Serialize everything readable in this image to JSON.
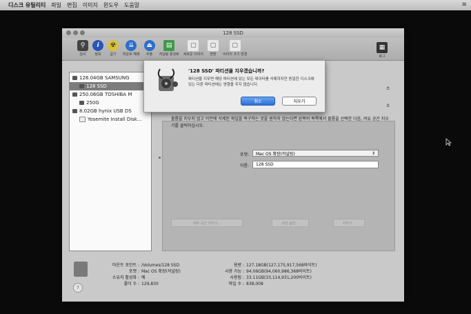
{
  "menubar": {
    "app_name": "디스크 유틸리티",
    "items": [
      "파일",
      "편집",
      "이미지",
      "윈도우",
      "도움말"
    ]
  },
  "window": {
    "title": "128 SSD"
  },
  "toolbar": {
    "items": [
      "검사",
      "정보",
      "굽기",
      "마운트 해제",
      "추출",
      "저널링 활성화",
      "새로운 이미지",
      "변환",
      "이미지 크기 변경"
    ],
    "log_label": "로그"
  },
  "sidebar": {
    "items": [
      {
        "label": "128.04GB SAMSUNG",
        "selected": false
      },
      {
        "label": "128 SSD",
        "selected": true
      },
      {
        "label": "250.06GB TOSHIBA M",
        "selected": false
      },
      {
        "label": "250G",
        "selected": false
      },
      {
        "label": "8.02GB hynix USB DS",
        "selected": false
      },
      {
        "label": "Yosemite Install Disk...",
        "selected": false
      }
    ]
  },
  "dialog": {
    "title": "'128 SSD' 파티션을 지우겠습니까?",
    "message": "파티션을 지우면 해당 파티션에 있는 모든 데이터를 삭제하지만 동일한 디스크에 있는 다른 파티션에는 영향을 주지 않습니다.",
    "cancel_label": "취소",
    "erase_label": "지우기"
  },
  "main": {
    "hint_right": "소",
    "hint_right2": "소",
    "description": "볼륨을 지우지 않고 이전에 삭제된 파일을 복구하는 것을 원하지 않는다면 왼쪽의 목록에서 볼륨을 선택한 다음, 여유 공간 지우기를 클릭하십시오.",
    "format_label": "포맷:",
    "format_value": "Mac OS 확장(저널링)",
    "name_label": "이름:",
    "name_value": "128 SSD",
    "free_space_button": "여유 공간 지우기...",
    "security_button": "보안 옵션...",
    "erase_button": "지우기..."
  },
  "info": {
    "mount_point_label": "마운트 포인트 :",
    "mount_point_value": "/Volumes/128 SSD",
    "format_label": "포맷 :",
    "format_value": "Mac OS 확장(저널링)",
    "owner_label": "소유자 활성화 :",
    "owner_value": "예",
    "folders_label": "폴더 수 :",
    "folders_value": "129,830",
    "capacity_label": "용량 :",
    "capacity_value": "127.18GB(127,175,917,568바이트)",
    "available_label": "사용 가능 :",
    "available_value": "94.06GB(94,060,986,368바이트)",
    "used_label": "사용됨 :",
    "used_value": "33.11GB(33,114,931,200바이트)",
    "files_label": "파일 수 :",
    "files_value": "838,008"
  },
  "help": "?",
  "colors": {
    "accent": "#2c6fd8",
    "window_bg": "#c9c9c9",
    "desktop_bg": "#0a0a0b"
  }
}
